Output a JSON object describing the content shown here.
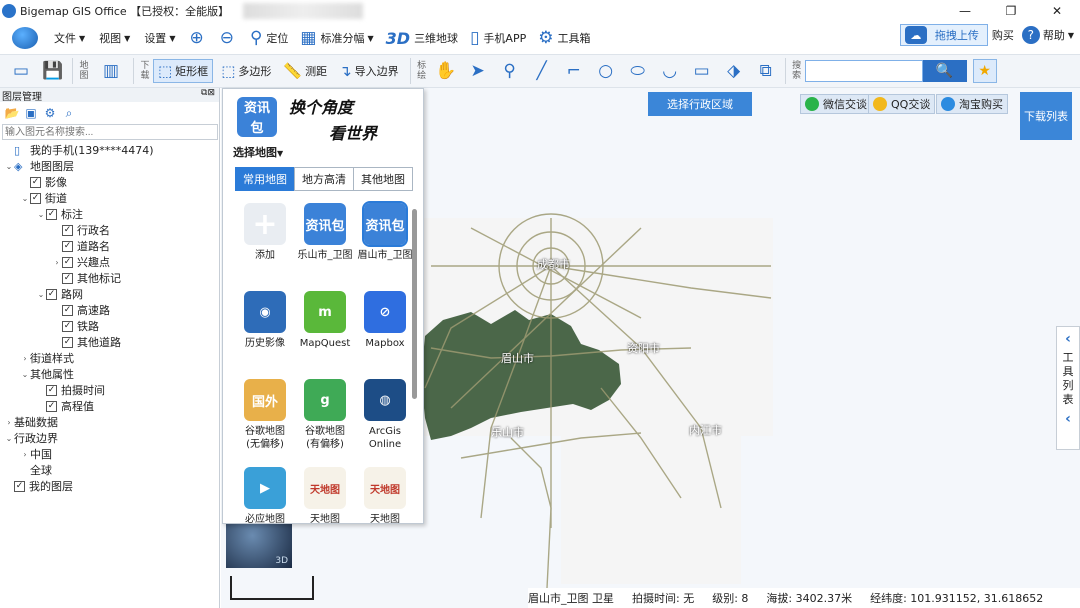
{
  "window": {
    "title": "Bigemap GIS Office 【已授权：全能版】",
    "controls": [
      "—",
      "❐",
      "✕"
    ]
  },
  "menu": {
    "items": [
      "文件",
      "视图",
      "设置"
    ]
  },
  "tools": [
    {
      "label": "定位",
      "icon": "location-pin-icon"
    },
    {
      "label": "标准分幅",
      "icon": "grid-icon"
    },
    {
      "label": "三维地球",
      "icon": "3d-icon"
    },
    {
      "label": "手机APP",
      "icon": "phone-icon"
    },
    {
      "label": "工具箱",
      "icon": "gear-icon"
    }
  ],
  "topright": {
    "upload": "拖拽上传",
    "buy": "购买",
    "help": "帮助"
  },
  "toolbar": {
    "label_map": "地图",
    "label_download": "下载",
    "rect": "矩形框",
    "polygon": "多边形",
    "measure": "测距",
    "import": "导入边界",
    "label_draw": "标绘",
    "label_search": "搜索",
    "search_icon": "🔍",
    "search_placeholder": ""
  },
  "layers": {
    "header": "图层管理",
    "search_placeholder": "输入图元名称搜索...",
    "tree": [
      {
        "depth": 0,
        "arrow": "",
        "check": null,
        "icon": "phone",
        "label": "我的手机(139****4474)"
      },
      {
        "depth": 0,
        "arrow": "⌄",
        "check": null,
        "icon": "layers",
        "label": "地图图层"
      },
      {
        "depth": 1,
        "arrow": "",
        "check": true,
        "label": "影像"
      },
      {
        "depth": 1,
        "arrow": "⌄",
        "check": true,
        "label": "街道"
      },
      {
        "depth": 2,
        "arrow": "⌄",
        "check": true,
        "label": "标注"
      },
      {
        "depth": 3,
        "arrow": "",
        "check": true,
        "label": "行政名"
      },
      {
        "depth": 3,
        "arrow": "",
        "check": true,
        "label": "道路名"
      },
      {
        "depth": 3,
        "arrow": "›",
        "check": true,
        "label": "兴趣点"
      },
      {
        "depth": 3,
        "arrow": "",
        "check": true,
        "label": "其他标记"
      },
      {
        "depth": 2,
        "arrow": "⌄",
        "check": true,
        "label": "路网"
      },
      {
        "depth": 3,
        "arrow": "",
        "check": true,
        "label": "高速路"
      },
      {
        "depth": 3,
        "arrow": "",
        "check": true,
        "label": "铁路"
      },
      {
        "depth": 3,
        "arrow": "",
        "check": true,
        "label": "其他道路"
      },
      {
        "depth": 1,
        "arrow": "›",
        "check": null,
        "label": "街道样式"
      },
      {
        "depth": 1,
        "arrow": "⌄",
        "check": null,
        "label": "其他属性"
      },
      {
        "depth": 2,
        "arrow": "",
        "check": true,
        "label": "拍摄时间"
      },
      {
        "depth": 2,
        "arrow": "",
        "check": true,
        "label": "高程值"
      },
      {
        "depth": 0,
        "arrow": "›",
        "check": null,
        "label": "基础数据"
      },
      {
        "depth": 0,
        "arrow": "⌄",
        "check": null,
        "label": "行政边界"
      },
      {
        "depth": 1,
        "arrow": "›",
        "check": null,
        "label": "中国"
      },
      {
        "depth": 1,
        "arrow": "",
        "check": null,
        "label": "全球"
      },
      {
        "depth": 0,
        "arrow": "",
        "check": true,
        "label": "我的图层"
      }
    ]
  },
  "picker": {
    "logo_line1": "资讯",
    "logo_line2": "包",
    "select_label": "选择地图",
    "banner_line1": "换个角度",
    "banner_line2": "看世界",
    "tabs": [
      "常用地图",
      "地方高清",
      "其他地图"
    ],
    "maps": [
      {
        "label": "添加",
        "icon": "plus-icon",
        "color": "#e9edf2",
        "glyph": "+"
      },
      {
        "label": "乐山市_卫图",
        "icon": "package-icon",
        "color": "#3b82d8",
        "glyph": "资讯包"
      },
      {
        "label": "眉山市_卫图",
        "icon": "package-icon",
        "color": "#3b82d8",
        "glyph": "资讯包"
      },
      {
        "label": "历史影像",
        "icon": "earth-icon",
        "color": "#2e6cb8",
        "glyph": "◉"
      },
      {
        "label": "MapQuest",
        "icon": "mapquest-icon",
        "color": "#5ab83a",
        "glyph": "m"
      },
      {
        "label": "Mapbox",
        "icon": "mapbox-icon",
        "color": "#2f6ee0",
        "glyph": "⊘"
      },
      {
        "label": "谷歌地图\n(无偏移)",
        "icon": "google-maps-icon",
        "color": "#e8b04a",
        "glyph": "国外"
      },
      {
        "label": "谷歌地图\n(有偏移)",
        "icon": "google-maps-icon",
        "color": "#3faa56",
        "glyph": "g"
      },
      {
        "label": "ArcGis\nOnline",
        "icon": "globe-icon",
        "color": "#1d4d86",
        "glyph": "◍"
      },
      {
        "label": "必应地图",
        "icon": "bing-icon",
        "color": "#3aa0d8",
        "glyph": "▶"
      },
      {
        "label": "天地图",
        "icon": "tianditu-icon",
        "color": "#f6f2e8",
        "glyph": "天地图"
      },
      {
        "label": "天地图",
        "icon": "tianditu-icon",
        "color": "#f6f2e8",
        "glyph": "天地图"
      }
    ]
  },
  "map": {
    "region_button": "选择行政区域",
    "social": [
      {
        "label": "微信交谈",
        "color": "#2ab34a"
      },
      {
        "label": "QQ交谈",
        "color": "#f2b81c"
      },
      {
        "label": "淘宝购买",
        "color": "#2b8be0"
      }
    ],
    "download_list": "下载列表",
    "tool_list": "工具列表",
    "cities": [
      {
        "name": "成都市"
      },
      {
        "name": "眉山市"
      },
      {
        "name": "资阳市"
      },
      {
        "name": "乐山市"
      },
      {
        "name": "内江市"
      }
    ],
    "badge_3d": "3D"
  },
  "status": {
    "layer": "眉山市_卫图 卫星",
    "shot_time": "拍摄时间: 无",
    "level": "级别:  8",
    "altitude": "海拔: 3402.37米",
    "coords": "经纬度:  101.931152, 31.618652"
  }
}
